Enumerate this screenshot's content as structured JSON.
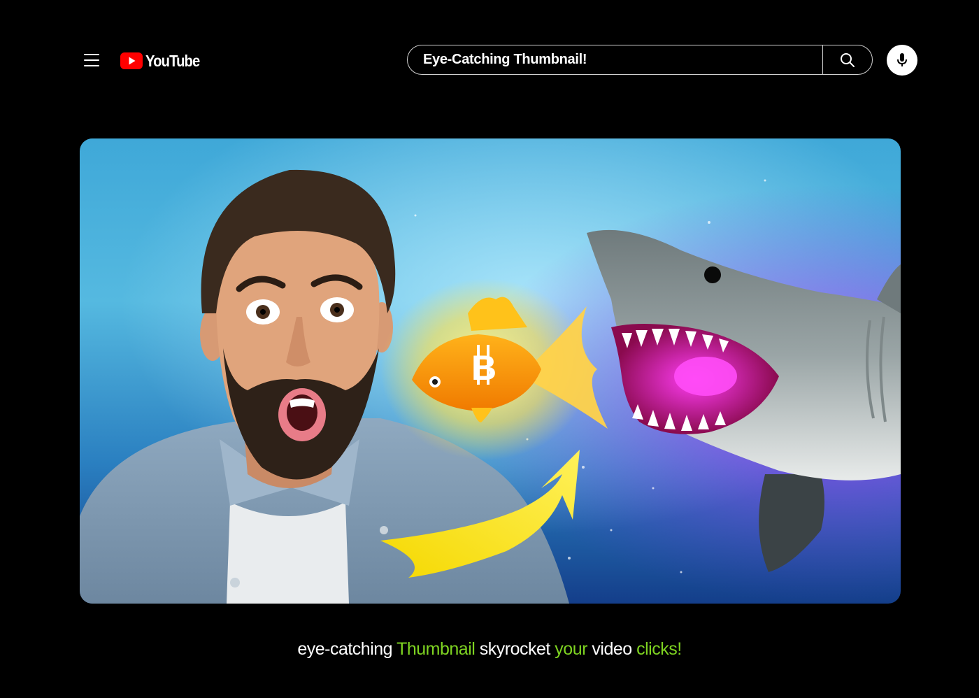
{
  "header": {
    "logo_text": "YouTube",
    "search": {
      "value": "Eye-Catching Thumbnail!"
    }
  },
  "icons": {
    "menu": "hamburger-menu-icon",
    "logo": "youtube-play-icon",
    "search": "search-icon",
    "mic": "microphone-icon",
    "coin": "bitcoin-icon"
  },
  "thumbnail": {
    "coin_symbol": "B"
  },
  "caption": {
    "parts": [
      {
        "text": "eye-catching ",
        "highlight": false
      },
      {
        "text": "Thumbnail",
        "highlight": true
      },
      {
        "text": " skyrocket ",
        "highlight": false
      },
      {
        "text": "your",
        "highlight": true
      },
      {
        "text": " video ",
        "highlight": false
      },
      {
        "text": "clicks!",
        "highlight": true
      }
    ]
  },
  "colors": {
    "background": "#000000",
    "brand_red": "#ff0000",
    "highlight_green": "#7ed321",
    "text": "#ffffff"
  }
}
